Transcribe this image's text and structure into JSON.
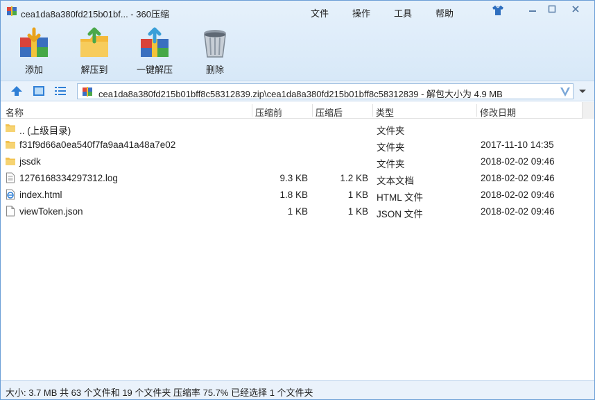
{
  "window": {
    "title": "cea1da8a380fd215b01bf... - 360压缩"
  },
  "menu": {
    "items": [
      "文件",
      "操作",
      "工具",
      "帮助"
    ]
  },
  "toolbar": {
    "add_label": "添加",
    "extract_to_label": "解压到",
    "one_click_extract_label": "一键解压",
    "delete_label": "删除"
  },
  "address": {
    "path": "cea1da8a380fd215b01bff8c58312839.zip\\cea1da8a380fd215b01bff8c58312839 - 解包大小为 4.9 MB"
  },
  "columns": {
    "name": "名称",
    "before": "压缩前",
    "after": "压缩后",
    "type": "类型",
    "modified": "修改日期"
  },
  "files": [
    {
      "icon": "folder-up-icon",
      "name": ".. (上级目录)",
      "before": "",
      "after": "",
      "type": "文件夹",
      "date": ""
    },
    {
      "icon": "folder-icon",
      "name": "f31f9d66a0ea540f7fa9aa41a48a7e02",
      "before": "",
      "after": "",
      "type": "文件夹",
      "date": "2017-11-10 14:35"
    },
    {
      "icon": "folder-icon",
      "name": "jssdk",
      "before": "",
      "after": "",
      "type": "文件夹",
      "date": "2018-02-02 09:46"
    },
    {
      "icon": "text-file-icon",
      "name": "1276168334297312.log",
      "before": "9.3 KB",
      "after": "1.2 KB",
      "type": "文本文档",
      "date": "2018-02-02 09:46"
    },
    {
      "icon": "html-file-icon",
      "name": "index.html",
      "before": "1.8 KB",
      "after": "1 KB",
      "type": "HTML 文件",
      "date": "2018-02-02 09:46"
    },
    {
      "icon": "json-file-icon",
      "name": "viewToken.json",
      "before": "1 KB",
      "after": "1 KB",
      "type": "JSON 文件",
      "date": "2018-02-02 09:46"
    }
  ],
  "status": {
    "text": "大小: 3.7 MB 共 63 个文件和 19 个文件夹 压缩率 75.7% 已经选择 1 个文件夹"
  },
  "colors": {
    "accent": "#3a7fd0",
    "folder": "#f2c14e",
    "toolbar_bg": "#dbeaf8"
  }
}
